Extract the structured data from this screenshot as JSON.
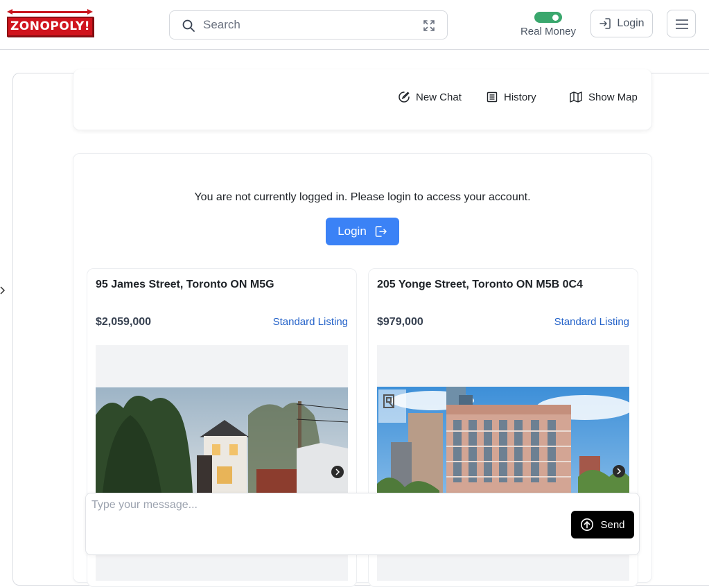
{
  "header": {
    "logo_text": "ZONOPOLY!",
    "search_placeholder": "Search",
    "toggle_label": "Real Money",
    "toggle_on": true,
    "login_label": "Login"
  },
  "toolbar": {
    "new_chat": "New Chat",
    "history": "History",
    "show_map": "Show Map"
  },
  "main": {
    "notice": "You are not currently logged in. Please login to access your account.",
    "login_button": "Login"
  },
  "listings": [
    {
      "address": "95 James Street, Toronto ON M5G",
      "price": "$2,059,000",
      "tag": "Standard Listing"
    },
    {
      "address": "205 Yonge Street, Toronto ON M5B 0C4",
      "price": "$979,000",
      "tag": "Standard Listing"
    }
  ],
  "chat": {
    "placeholder": "Type your message...",
    "send_label": "Send"
  },
  "colors": {
    "brand_red": "#d0141d",
    "toggle_green": "#3aa76d",
    "primary_blue": "#3b82f6",
    "link_blue": "#2563c9"
  }
}
